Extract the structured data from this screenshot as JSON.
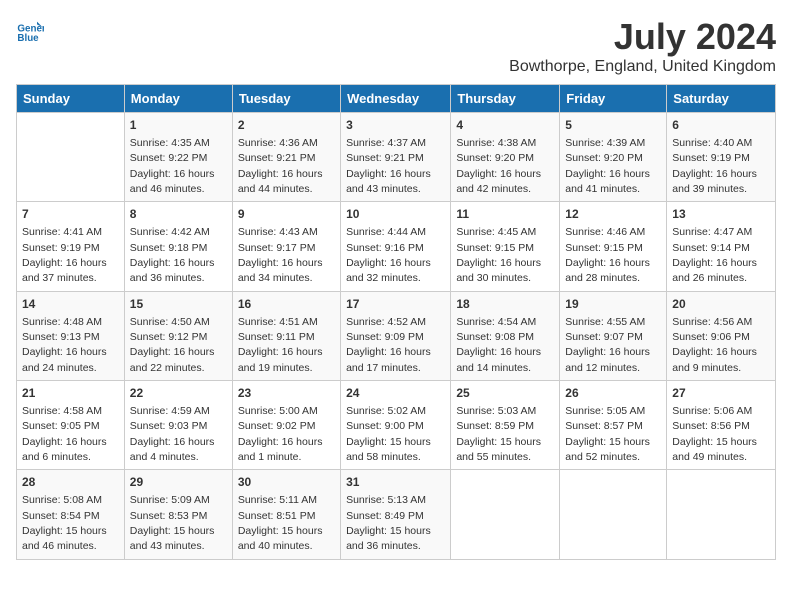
{
  "logo": {
    "line1": "General",
    "line2": "Blue"
  },
  "title": "July 2024",
  "subtitle": "Bowthorpe, England, United Kingdom",
  "days_of_week": [
    "Sunday",
    "Monday",
    "Tuesday",
    "Wednesday",
    "Thursday",
    "Friday",
    "Saturday"
  ],
  "weeks": [
    [
      {
        "day": "",
        "info": ""
      },
      {
        "day": "1",
        "info": "Sunrise: 4:35 AM\nSunset: 9:22 PM\nDaylight: 16 hours and 46 minutes."
      },
      {
        "day": "2",
        "info": "Sunrise: 4:36 AM\nSunset: 9:21 PM\nDaylight: 16 hours and 44 minutes."
      },
      {
        "day": "3",
        "info": "Sunrise: 4:37 AM\nSunset: 9:21 PM\nDaylight: 16 hours and 43 minutes."
      },
      {
        "day": "4",
        "info": "Sunrise: 4:38 AM\nSunset: 9:20 PM\nDaylight: 16 hours and 42 minutes."
      },
      {
        "day": "5",
        "info": "Sunrise: 4:39 AM\nSunset: 9:20 PM\nDaylight: 16 hours and 41 minutes."
      },
      {
        "day": "6",
        "info": "Sunrise: 4:40 AM\nSunset: 9:19 PM\nDaylight: 16 hours and 39 minutes."
      }
    ],
    [
      {
        "day": "7",
        "info": "Sunrise: 4:41 AM\nSunset: 9:19 PM\nDaylight: 16 hours and 37 minutes."
      },
      {
        "day": "8",
        "info": "Sunrise: 4:42 AM\nSunset: 9:18 PM\nDaylight: 16 hours and 36 minutes."
      },
      {
        "day": "9",
        "info": "Sunrise: 4:43 AM\nSunset: 9:17 PM\nDaylight: 16 hours and 34 minutes."
      },
      {
        "day": "10",
        "info": "Sunrise: 4:44 AM\nSunset: 9:16 PM\nDaylight: 16 hours and 32 minutes."
      },
      {
        "day": "11",
        "info": "Sunrise: 4:45 AM\nSunset: 9:15 PM\nDaylight: 16 hours and 30 minutes."
      },
      {
        "day": "12",
        "info": "Sunrise: 4:46 AM\nSunset: 9:15 PM\nDaylight: 16 hours and 28 minutes."
      },
      {
        "day": "13",
        "info": "Sunrise: 4:47 AM\nSunset: 9:14 PM\nDaylight: 16 hours and 26 minutes."
      }
    ],
    [
      {
        "day": "14",
        "info": "Sunrise: 4:48 AM\nSunset: 9:13 PM\nDaylight: 16 hours and 24 minutes."
      },
      {
        "day": "15",
        "info": "Sunrise: 4:50 AM\nSunset: 9:12 PM\nDaylight: 16 hours and 22 minutes."
      },
      {
        "day": "16",
        "info": "Sunrise: 4:51 AM\nSunset: 9:11 PM\nDaylight: 16 hours and 19 minutes."
      },
      {
        "day": "17",
        "info": "Sunrise: 4:52 AM\nSunset: 9:09 PM\nDaylight: 16 hours and 17 minutes."
      },
      {
        "day": "18",
        "info": "Sunrise: 4:54 AM\nSunset: 9:08 PM\nDaylight: 16 hours and 14 minutes."
      },
      {
        "day": "19",
        "info": "Sunrise: 4:55 AM\nSunset: 9:07 PM\nDaylight: 16 hours and 12 minutes."
      },
      {
        "day": "20",
        "info": "Sunrise: 4:56 AM\nSunset: 9:06 PM\nDaylight: 16 hours and 9 minutes."
      }
    ],
    [
      {
        "day": "21",
        "info": "Sunrise: 4:58 AM\nSunset: 9:05 PM\nDaylight: 16 hours and 6 minutes."
      },
      {
        "day": "22",
        "info": "Sunrise: 4:59 AM\nSunset: 9:03 PM\nDaylight: 16 hours and 4 minutes."
      },
      {
        "day": "23",
        "info": "Sunrise: 5:00 AM\nSunset: 9:02 PM\nDaylight: 16 hours and 1 minute."
      },
      {
        "day": "24",
        "info": "Sunrise: 5:02 AM\nSunset: 9:00 PM\nDaylight: 15 hours and 58 minutes."
      },
      {
        "day": "25",
        "info": "Sunrise: 5:03 AM\nSunset: 8:59 PM\nDaylight: 15 hours and 55 minutes."
      },
      {
        "day": "26",
        "info": "Sunrise: 5:05 AM\nSunset: 8:57 PM\nDaylight: 15 hours and 52 minutes."
      },
      {
        "day": "27",
        "info": "Sunrise: 5:06 AM\nSunset: 8:56 PM\nDaylight: 15 hours and 49 minutes."
      }
    ],
    [
      {
        "day": "28",
        "info": "Sunrise: 5:08 AM\nSunset: 8:54 PM\nDaylight: 15 hours and 46 minutes."
      },
      {
        "day": "29",
        "info": "Sunrise: 5:09 AM\nSunset: 8:53 PM\nDaylight: 15 hours and 43 minutes."
      },
      {
        "day": "30",
        "info": "Sunrise: 5:11 AM\nSunset: 8:51 PM\nDaylight: 15 hours and 40 minutes."
      },
      {
        "day": "31",
        "info": "Sunrise: 5:13 AM\nSunset: 8:49 PM\nDaylight: 15 hours and 36 minutes."
      },
      {
        "day": "",
        "info": ""
      },
      {
        "day": "",
        "info": ""
      },
      {
        "day": "",
        "info": ""
      }
    ]
  ]
}
